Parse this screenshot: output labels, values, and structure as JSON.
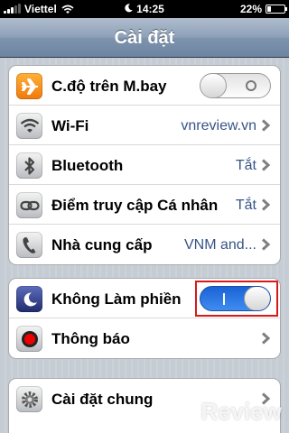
{
  "status_bar": {
    "carrier": "Viettel",
    "time": "14:25",
    "battery": "22%",
    "battery_level": 0.22
  },
  "nav": {
    "title": "Cài đặt"
  },
  "group1": {
    "airplane": {
      "label": "C.độ trên M.bay",
      "icon": "airplane-icon",
      "state": "off"
    },
    "wifi": {
      "label": "Wi-Fi",
      "value": "vnreview.vn",
      "icon": "wifi-icon"
    },
    "bluetooth": {
      "label": "Bluetooth",
      "value": "Tắt",
      "icon": "bluetooth-icon"
    },
    "hotspot": {
      "label": "Điểm truy cập Cá nhân",
      "value": "Tắt",
      "icon": "link-icon"
    },
    "carrier": {
      "label": "Nhà cung cấp",
      "value": "VNM and...",
      "icon": "phone-icon"
    }
  },
  "group2": {
    "dnd": {
      "label": "Không Làm phiền",
      "icon": "moon-icon",
      "state": "on"
    },
    "notifications": {
      "label": "Thông báo",
      "icon": "notification-icon"
    }
  },
  "group3": {
    "general": {
      "label": "Cài đặt chung",
      "icon": "gear-icon"
    }
  },
  "watermark": {
    "text": "Review"
  },
  "colors": {
    "value_blue": "#385487",
    "switch_on": "#2f7ae5",
    "highlight": "#d7191c"
  }
}
